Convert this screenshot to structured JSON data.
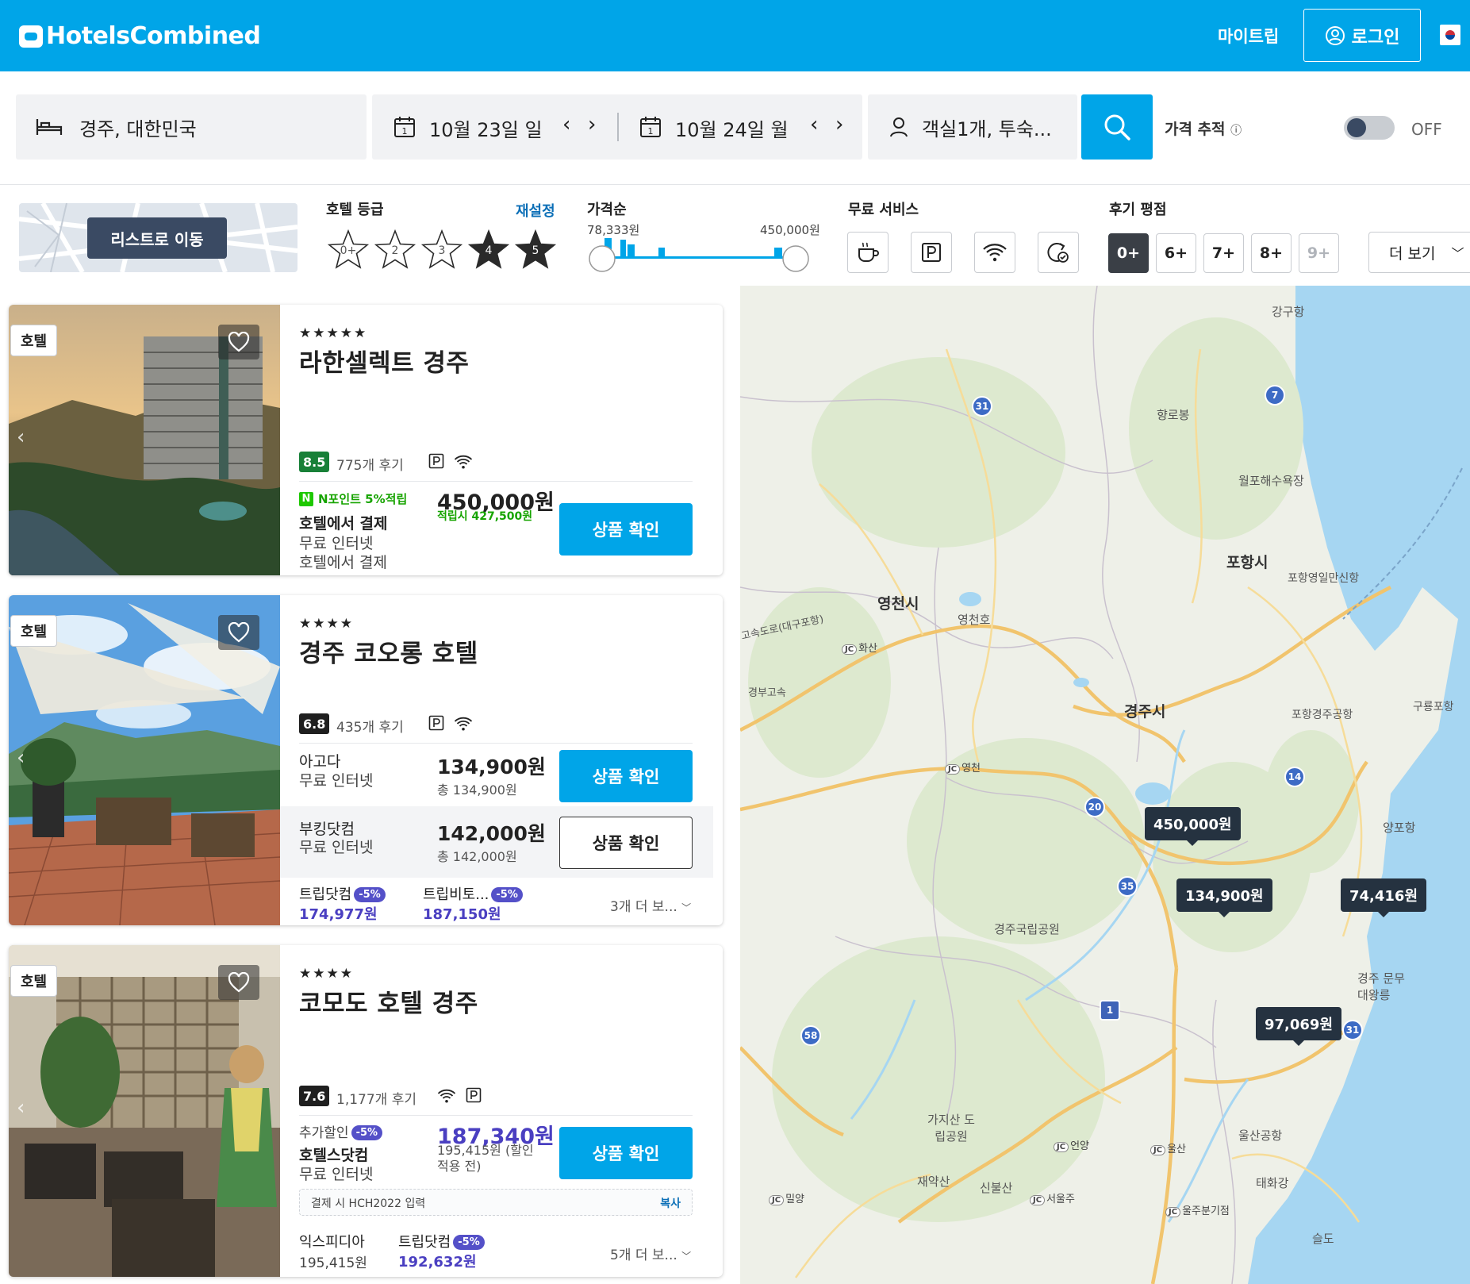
{
  "header": {
    "logo_text": "HotelsCombined",
    "my_trip": "마이트립",
    "login": "로그인"
  },
  "search": {
    "destination": "경주, 대한민국",
    "checkin": "10월 23일 일",
    "checkout": "10월 24일 월",
    "guests": "객실1개, 투숙...",
    "price_alert_label": "가격 추적",
    "price_alert_state": "OFF"
  },
  "filters": {
    "list_button": "리스트로 이동",
    "hotel_class_label": "호텔 등급",
    "reset_label": "재설정",
    "stars": [
      "0+",
      "2",
      "3",
      "4",
      "5"
    ],
    "price_label": "가격순",
    "price_min": "78,333원",
    "price_max": "450,000원",
    "free_services_label": "무료 서비스",
    "review_label": "후기 평점",
    "review_options": [
      "0+",
      "6+",
      "7+",
      "8+",
      "9+"
    ],
    "more_label": "더 보기"
  },
  "hotels": [
    {
      "type": "호텔",
      "stars": "★★★★★",
      "name": "라한셀렉트 경주",
      "score": "8.5",
      "reviews": "775개 후기",
      "npoint": "N포인트 5%적립",
      "provider": "호텔에서 결제",
      "amenity1": "무료 인터넷",
      "amenity2": "호텔에서 결제",
      "price": "450,000원",
      "price_sub": "적립시 427,500원",
      "cta": "상품 확인"
    },
    {
      "type": "호텔",
      "stars": "★★★★",
      "name": "경주 코오롱 호텔",
      "score": "6.8",
      "reviews": "435개 후기",
      "offers": [
        {
          "provider": "아고다",
          "amenity": "무료 인터넷",
          "price": "134,900원",
          "total": "총 134,900원",
          "cta": "상품 확인"
        },
        {
          "provider": "부킹닷컴",
          "amenity": "무료 인터넷",
          "price": "142,000원",
          "total": "총 142,000원",
          "cta": "상품 확인"
        }
      ],
      "extra": [
        {
          "provider": "트립닷컴",
          "discount": "-5%",
          "price": "174,977원"
        },
        {
          "provider": "트립비토...",
          "discount": "-5%",
          "price": "187,150원"
        }
      ],
      "more": "3개 더 보..."
    },
    {
      "type": "호텔",
      "stars": "★★★★",
      "name": "코모도 호텔 경주",
      "score": "7.6",
      "reviews": "1,177개 후기",
      "extra_discount_label": "추가할인",
      "extra_discount": "-5%",
      "provider": "호텔스닷컴",
      "amenity": "무료 인터넷",
      "price": "187,340원",
      "price_before": "195,415원 (할인 적용 전)",
      "cta": "상품 확인",
      "coupon_text": "결제 시 HCH2022 입력",
      "coupon_copy": "복사",
      "extra": [
        {
          "provider": "익스피디아",
          "price": "195,415원"
        },
        {
          "provider": "트립닷컴",
          "discount": "-5%",
          "price": "192,632원"
        }
      ],
      "more": "5개 더 보..."
    }
  ],
  "map": {
    "pins": [
      "450,000원",
      "134,900원",
      "74,416원",
      "97,069원"
    ],
    "cities": [
      "영천시",
      "포항시",
      "경주시"
    ],
    "labels": [
      "강구항",
      "향로봉",
      "월포해수욕장",
      "포항영일만신항",
      "영천호",
      "포항경주공항",
      "구룡포항",
      "양포항",
      "경주국립공원",
      "경주 문무대왕릉",
      "울산공항",
      "태화강",
      "가지산 도립공원",
      "재약산",
      "신불산",
      "슬도",
      "경부고속",
      "고속도로(대구포항)"
    ],
    "jc": [
      "화산",
      "영천",
      "언양",
      "울산",
      "밀양",
      "서울주",
      "울주분기점"
    ],
    "roads": [
      "31",
      "7",
      "14",
      "20",
      "35",
      "1",
      "58",
      "31"
    ]
  },
  "colors": {
    "brand": "#00a5e8",
    "dark": "#253240",
    "score_good": "#188038",
    "discount": "#5450c8"
  }
}
